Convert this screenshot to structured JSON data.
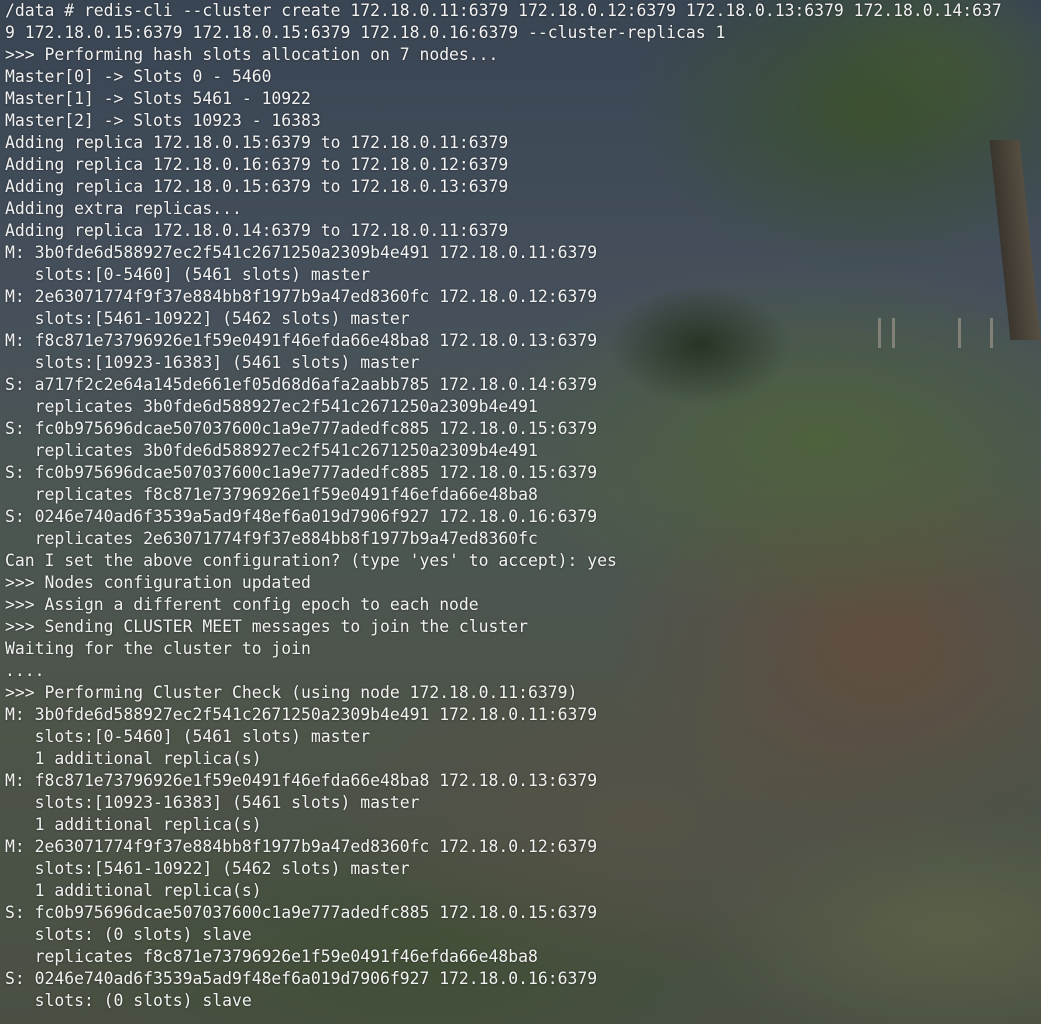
{
  "terminal": {
    "lines": [
      "/data # redis-cli --cluster create 172.18.0.11:6379 172.18.0.12:6379 172.18.0.13:6379 172.18.0.14:637",
      "9 172.18.0.15:6379 172.18.0.15:6379 172.18.0.16:6379 --cluster-replicas 1",
      ">>> Performing hash slots allocation on 7 nodes...",
      "Master[0] -> Slots 0 - 5460",
      "Master[1] -> Slots 5461 - 10922",
      "Master[2] -> Slots 10923 - 16383",
      "Adding replica 172.18.0.15:6379 to 172.18.0.11:6379",
      "Adding replica 172.18.0.16:6379 to 172.18.0.12:6379",
      "Adding replica 172.18.0.15:6379 to 172.18.0.13:6379",
      "Adding extra replicas...",
      "Adding replica 172.18.0.14:6379 to 172.18.0.11:6379",
      "M: 3b0fde6d588927ec2f541c2671250a2309b4e491 172.18.0.11:6379",
      "   slots:[0-5460] (5461 slots) master",
      "M: 2e63071774f9f37e884bb8f1977b9a47ed8360fc 172.18.0.12:6379",
      "   slots:[5461-10922] (5462 slots) master",
      "M: f8c871e73796926e1f59e0491f46efda66e48ba8 172.18.0.13:6379",
      "   slots:[10923-16383] (5461 slots) master",
      "S: a717f2c2e64a145de661ef05d68d6afa2aabb785 172.18.0.14:6379",
      "   replicates 3b0fde6d588927ec2f541c2671250a2309b4e491",
      "S: fc0b975696dcae507037600c1a9e777adedfc885 172.18.0.15:6379",
      "   replicates 3b0fde6d588927ec2f541c2671250a2309b4e491",
      "S: fc0b975696dcae507037600c1a9e777adedfc885 172.18.0.15:6379",
      "   replicates f8c871e73796926e1f59e0491f46efda66e48ba8",
      "S: 0246e740ad6f3539a5ad9f48ef6a019d7906f927 172.18.0.16:6379",
      "   replicates 2e63071774f9f37e884bb8f1977b9a47ed8360fc",
      "Can I set the above configuration? (type 'yes' to accept): yes",
      ">>> Nodes configuration updated",
      ">>> Assign a different config epoch to each node",
      ">>> Sending CLUSTER MEET messages to join the cluster",
      "Waiting for the cluster to join",
      "....",
      ">>> Performing Cluster Check (using node 172.18.0.11:6379)",
      "M: 3b0fde6d588927ec2f541c2671250a2309b4e491 172.18.0.11:6379",
      "   slots:[0-5460] (5461 slots) master",
      "   1 additional replica(s)",
      "M: f8c871e73796926e1f59e0491f46efda66e48ba8 172.18.0.13:6379",
      "   slots:[10923-16383] (5461 slots) master",
      "   1 additional replica(s)",
      "M: 2e63071774f9f37e884bb8f1977b9a47ed8360fc 172.18.0.12:6379",
      "   slots:[5461-10922] (5462 slots) master",
      "   1 additional replica(s)",
      "S: fc0b975696dcae507037600c1a9e777adedfc885 172.18.0.15:6379",
      "   slots: (0 slots) slave",
      "   replicates f8c871e73796926e1f59e0491f46efda66e48ba8",
      "S: 0246e740ad6f3539a5ad9f48ef6a019d7906f927 172.18.0.16:6379",
      "   slots: (0 slots) slave"
    ]
  }
}
